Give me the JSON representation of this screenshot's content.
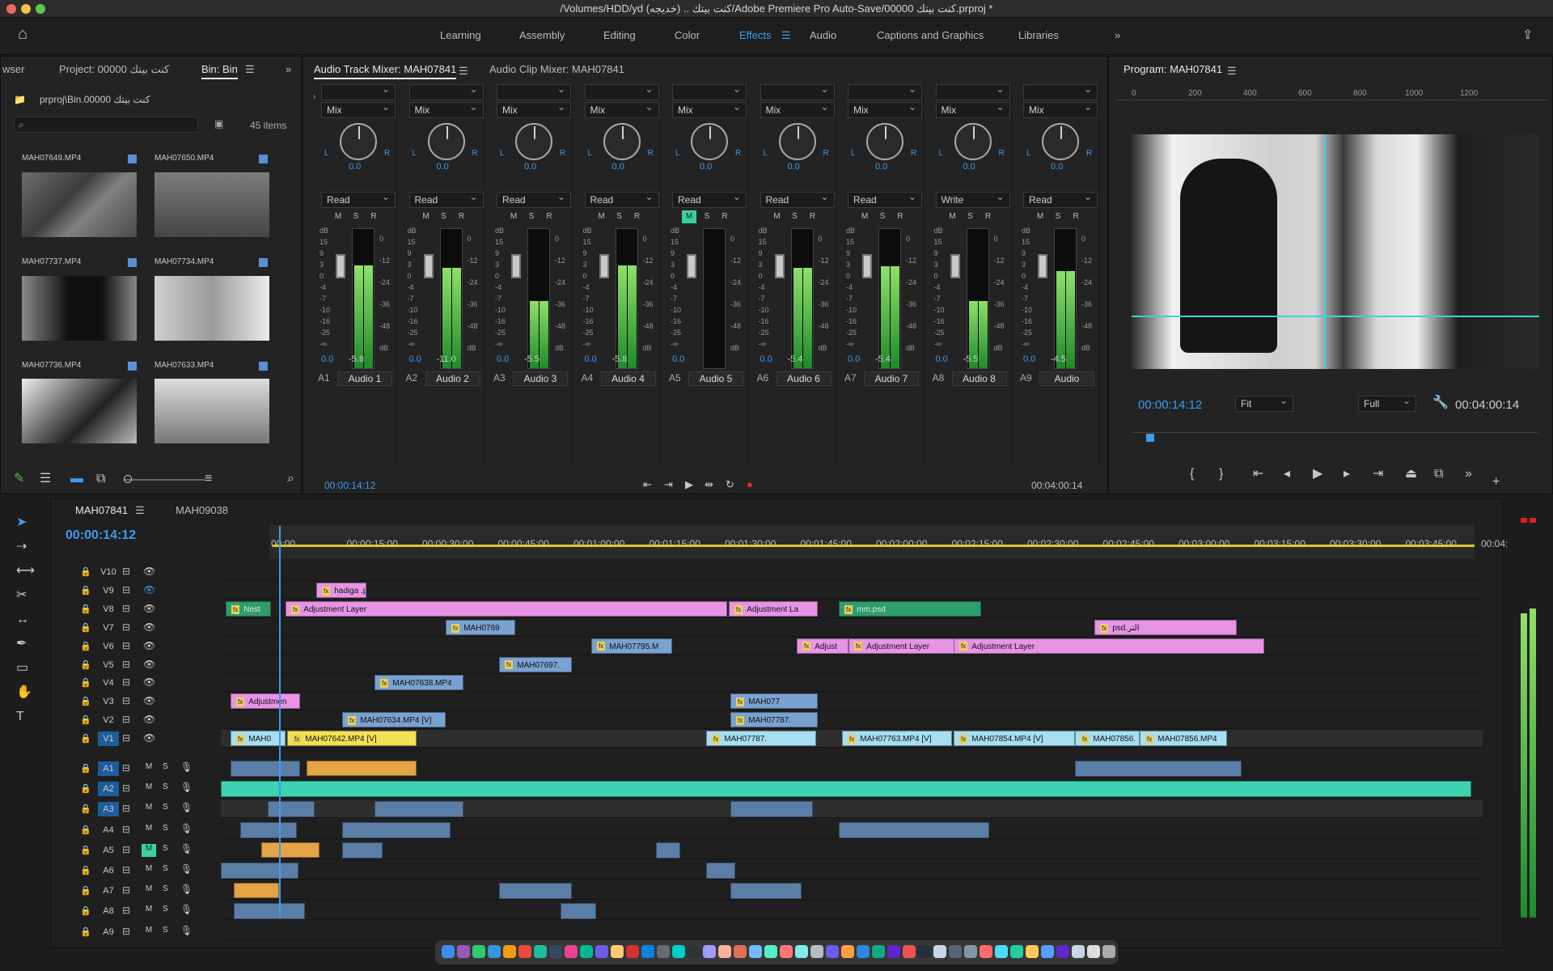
{
  "window": {
    "title": "/Volumes/HDD/yd (خديجه) .. كنت بيتك/Adobe Premiere Pro Auto-Save/00000 كنت بيتك.prproj *"
  },
  "workspaces": [
    "Learning",
    "Assembly",
    "Editing",
    "Color",
    "Effects",
    "Audio",
    "Captions and Graphics",
    "Libraries"
  ],
  "active_workspace": "Effects",
  "project_panel": {
    "tabs": [
      "wser",
      "Project: 00000 كنت بيتك",
      "Bin: Bin"
    ],
    "path": "prproj\\Bin.00000 كنت بيتك",
    "item_count": "45 items",
    "clips": [
      {
        "name": "MAH07649.MP4"
      },
      {
        "name": "MAH07650.MP4"
      },
      {
        "name": "MAH07737.MP4"
      },
      {
        "name": "MAH07734.MP4"
      },
      {
        "name": "MAH07736.MP4"
      },
      {
        "name": "MAH07633.MP4"
      }
    ]
  },
  "mixer": {
    "tabs": [
      "Audio Track Mixer: MAH07841",
      "Audio Clip Mixer: MAH07841"
    ],
    "channels": [
      {
        "id": "A1",
        "name": "Audio 1",
        "mode": "Read",
        "pan": "0.0",
        "vol": "0.0",
        "peak": "-5.8",
        "level": 0.74,
        "mute": false
      },
      {
        "id": "A2",
        "name": "Audio 2",
        "mode": "Read",
        "pan": "0.0",
        "vol": "0.0",
        "peak": "-11.0",
        "level": 0.72,
        "mute": false
      },
      {
        "id": "A3",
        "name": "Audio 3",
        "mode": "Read",
        "pan": "0.0",
        "vol": "0.0",
        "peak": "-5.5",
        "level": 0.48,
        "mute": false
      },
      {
        "id": "A4",
        "name": "Audio 4",
        "mode": "Read",
        "pan": "0.0",
        "vol": "0.0",
        "peak": "-5.8",
        "level": 0.74,
        "mute": false
      },
      {
        "id": "A5",
        "name": "Audio 5",
        "mode": "Read",
        "pan": "0.0",
        "vol": "0.0",
        "peak": "",
        "level": 0.0,
        "mute": true
      },
      {
        "id": "A6",
        "name": "Audio 6",
        "mode": "Read",
        "pan": "0.0",
        "vol": "0.0",
        "peak": "-5.4",
        "level": 0.72,
        "mute": false
      },
      {
        "id": "A7",
        "name": "Audio 7",
        "mode": "Read",
        "pan": "0.0",
        "vol": "0.0",
        "peak": "-5.4",
        "level": 0.73,
        "mute": false
      },
      {
        "id": "A8",
        "name": "Audio 8",
        "mode": "Write",
        "pan": "0.0",
        "vol": "0.0",
        "peak": "-5.5",
        "level": 0.48,
        "mute": false
      },
      {
        "id": "A9",
        "name": "Audio",
        "mode": "Read",
        "pan": "0.0",
        "vol": "0.0",
        "peak": "-4.5",
        "level": 0.7,
        "mute": false
      }
    ],
    "pan_mode": "Mix",
    "db_left": [
      "dB",
      "15",
      "9",
      "3",
      "0",
      "-4",
      "-7",
      "-10",
      "-16",
      "-25",
      "-∞"
    ],
    "db_right": [
      "0",
      "-12",
      "-24",
      "-36",
      "-48",
      "dB"
    ],
    "timecode_in": "00:00:14:12",
    "timecode_out": "00:04:00:14"
  },
  "program": {
    "title": "Program: MAH07841",
    "timecode": "00:00:14:12",
    "duration": "00:04:00:14",
    "fit": "Fit",
    "quality": "Full",
    "ruler": [
      "0",
      "200",
      "400",
      "600",
      "800",
      "1000",
      "1200"
    ]
  },
  "timeline": {
    "tabs": [
      "MAH07841",
      "MAH09038"
    ],
    "timecode": "00:00:14:12",
    "ruler": [
      "00:00",
      "00:00:15:00",
      "00:00:30:00",
      "00:00:45:00",
      "00:01:00:00",
      "00:01:15:00",
      "00:01:30:00",
      "00:01:45:00",
      "00:02:00:00",
      "00:02:15:00",
      "00:02:30:00",
      "00:02:45:00",
      "00:03:00:00",
      "00:03:15:00",
      "00:03:30:00",
      "00:03:45:00",
      "00:04:"
    ],
    "video_tracks": [
      "V10",
      "V9",
      "V8",
      "V7",
      "V6",
      "V5",
      "V4",
      "V3",
      "V2",
      "V1"
    ],
    "audio_tracks": [
      "A1",
      "A2",
      "A3",
      "A4",
      "A5",
      "A6",
      "A7",
      "A8",
      "A9"
    ],
    "clips": {
      "v9a": "hadiga .p",
      "v8a": "Nest",
      "v8b": "Adjustment Layer",
      "v8c": "Adjustment La",
      "v8d": "mm.psd",
      "v7a": "MAH0769",
      "v7b": "psd.التر",
      "v6a": "MAH07795.M",
      "v6b": "Adjust",
      "v6c": "Adjustment Layer",
      "v6d": "Adjustment Layer",
      "v5a": "MAH07697.",
      "v4a": "MAH07638.MP4",
      "v3a": "Adjustmen",
      "v3b": "MAH077",
      "v2a": "MAH07634.MP4 [V]",
      "v2b": "MAH07787.",
      "v1a": "MAH0",
      "v1b": "MAH07642.MP4 [V]",
      "v1c": "MAH07787.",
      "v1d": "MAH07763.MP4 [V]",
      "v1e": "MAH07854.MP4 [V]",
      "v1f": "MAH07856.",
      "v1g": "MAH07856.MP4"
    }
  }
}
